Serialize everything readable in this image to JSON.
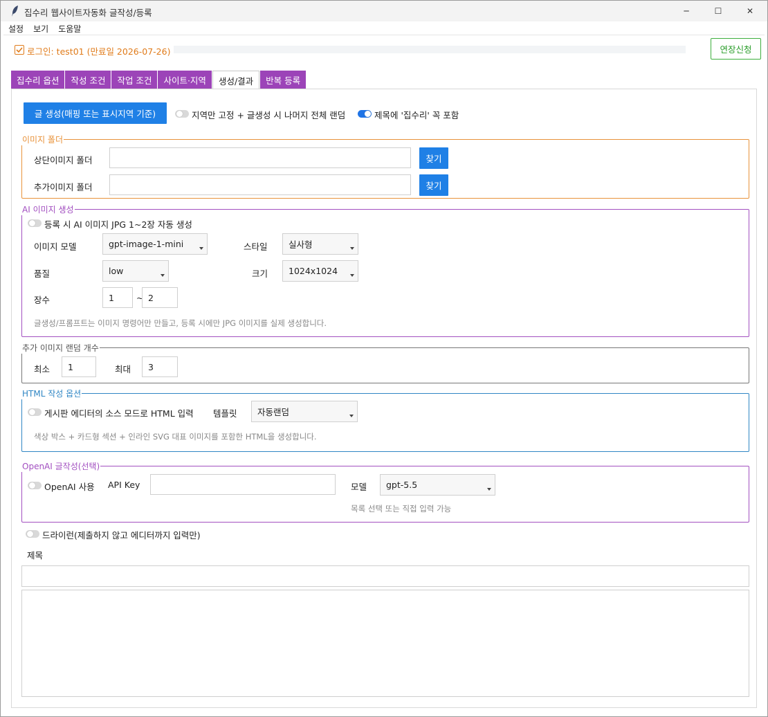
{
  "window": {
    "title": "집수리 웹사이트자동화 글작성/등록",
    "minimize_glyph": "─",
    "maximize_glyph": "☐",
    "close_glyph": "✕"
  },
  "menu": [
    "설정",
    "보기",
    "도움말"
  ],
  "login": {
    "text": "로그인: test01 (만료일 2026-07-26)",
    "extend_label": "연장신청",
    "progress_fraction": 0
  },
  "tabs": [
    {
      "label": "집수리 옵션",
      "active": false
    },
    {
      "label": "작성 조건",
      "active": false
    },
    {
      "label": "작업 조건",
      "active": false
    },
    {
      "label": "사이트·지역",
      "active": false
    },
    {
      "label": "생성/결과",
      "active": true
    },
    {
      "label": "반복 등록",
      "active": false
    }
  ],
  "generate": {
    "button_label": "글 생성(매핑 또는 표시지역 기준)",
    "fixed_region_label": "지역만 고정 + 글생성 시 나머지 전체 랜덤",
    "fixed_region_on": false,
    "title_include_label": "제목에 '집수리' 꼭 포함",
    "title_include_on": true
  },
  "image_folder": {
    "legend": "이미지 폴더",
    "top_label": "상단이미지 폴더",
    "top_value": "",
    "extra_label": "추가이미지 폴더",
    "extra_value": "",
    "find_label": "찾기"
  },
  "ai_image": {
    "legend": "AI 이미지 생성",
    "auto_label": "등록 시 AI 이미지 JPG 1~2장 자동 생성",
    "auto_on": false,
    "model_label": "이미지 모델",
    "model_value": "gpt-image-1-mini",
    "style_label": "스타일",
    "style_value": "실사형",
    "quality_label": "품질",
    "quality_value": "low",
    "size_label": "크기",
    "size_value": "1024x1024",
    "count_label": "장수",
    "count_min": "1",
    "count_sep": "~",
    "count_max": "2",
    "note": "글생성/프롬프트는 이미지 명령어만 만들고, 등록 시에만 JPG 이미지를 실제 생성합니다."
  },
  "extra_random": {
    "legend": "추가 이미지 랜덤 개수",
    "min_label": "최소",
    "min_value": "1",
    "max_label": "최대",
    "max_value": "3"
  },
  "html_options": {
    "legend": "HTML 작성 옵션",
    "source_mode_label": "게시판 에디터의 소스 모드로 HTML 입력",
    "source_mode_on": false,
    "template_label": "템플릿",
    "template_value": "자동랜덤",
    "note": "색상 박스 + 카드형 섹션 + 인라인 SVG 대표 이미지를 포함한 HTML을 생성합니다."
  },
  "openai": {
    "legend": "OpenAI 글작성(선택)",
    "use_label": "OpenAI 사용",
    "use_on": false,
    "apikey_label": "API Key",
    "apikey_value": "",
    "model_label": "모델",
    "model_value": "gpt-5.5",
    "note": "목록 선택 또는 직접 입력 가능"
  },
  "dryrun": {
    "label": "드라이런(제출하지 않고 에디터까지 입력만)",
    "on": false
  },
  "result": {
    "title_label": "제목",
    "title_value": "",
    "body_value": ""
  },
  "colors": {
    "tab_purple": "#9c44b8",
    "primary_blue": "#1f80e6",
    "login_orange": "#e07b1a",
    "extend_green": "#2a9d2a",
    "image_folder_border": "#e8923a",
    "ai_image_border": "#a24fc0",
    "extra_random_border": "#777777",
    "html_options_border": "#2f86c4",
    "openai_border": "#a24fc0"
  }
}
